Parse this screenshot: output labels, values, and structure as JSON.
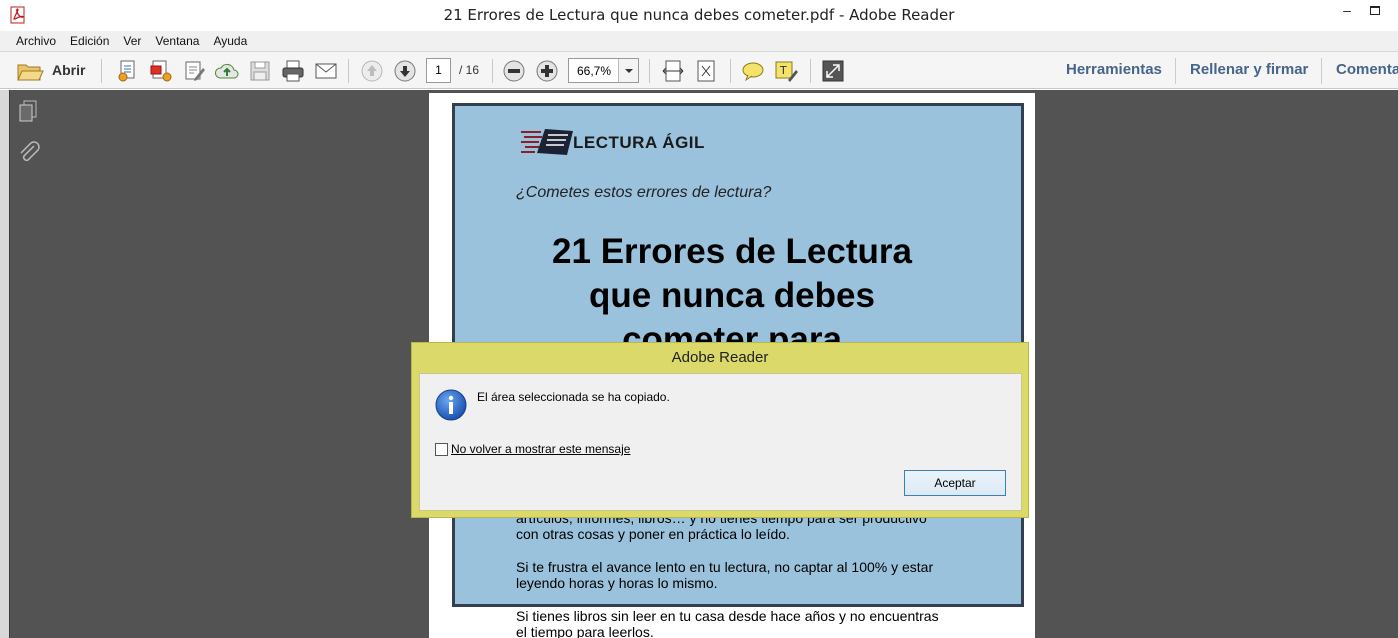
{
  "window": {
    "title": "21 Errores de Lectura que nunca debes cometer.pdf - Adobe Reader",
    "app_icon": "pdf-icon"
  },
  "menubar": {
    "items": [
      {
        "label": "Archivo"
      },
      {
        "label": "Edición"
      },
      {
        "label": "Ver"
      },
      {
        "label": "Ventana"
      },
      {
        "label": "Ayuda"
      }
    ]
  },
  "toolbar": {
    "open_label": "Abrir",
    "page_current": "1",
    "page_total": "/ 16",
    "zoom": "66,7%",
    "right_links": [
      {
        "label": "Herramientas"
      },
      {
        "label": "Rellenar y firmar"
      },
      {
        "label": "Comentar"
      }
    ]
  },
  "document": {
    "logo_text": "LECTURA ÁGIL",
    "tagline": "¿Cometes estos errores de lectura?",
    "headline_lines": [
      "21 Errores de Lectura",
      "que nunca debes",
      "cometer para"
    ],
    "body": [
      "artículos, informes, libros… y no tienes tiempo para ser productivo",
      "con otras cosas y poner en práctica lo leído.",
      "Si te frustra el avance lento en tu lectura, no captar al 100% y estar",
      "leyendo horas y horas lo mismo.",
      "Si tienes libros sin leer en tu casa desde hace años y no encuentras",
      "el tiempo para leerlos."
    ]
  },
  "dialog": {
    "title": "Adobe Reader",
    "message": "El área seleccionada se ha copiado.",
    "checkbox_label": "No volver a mostrar este mensaje",
    "checkbox_checked": false,
    "ok_label": "Aceptar"
  },
  "colors": {
    "dialog_frame": "#dbd96a",
    "cover_bg": "#9ac2dc",
    "link_color": "#47648a",
    "viewport_bg": "#535353"
  }
}
